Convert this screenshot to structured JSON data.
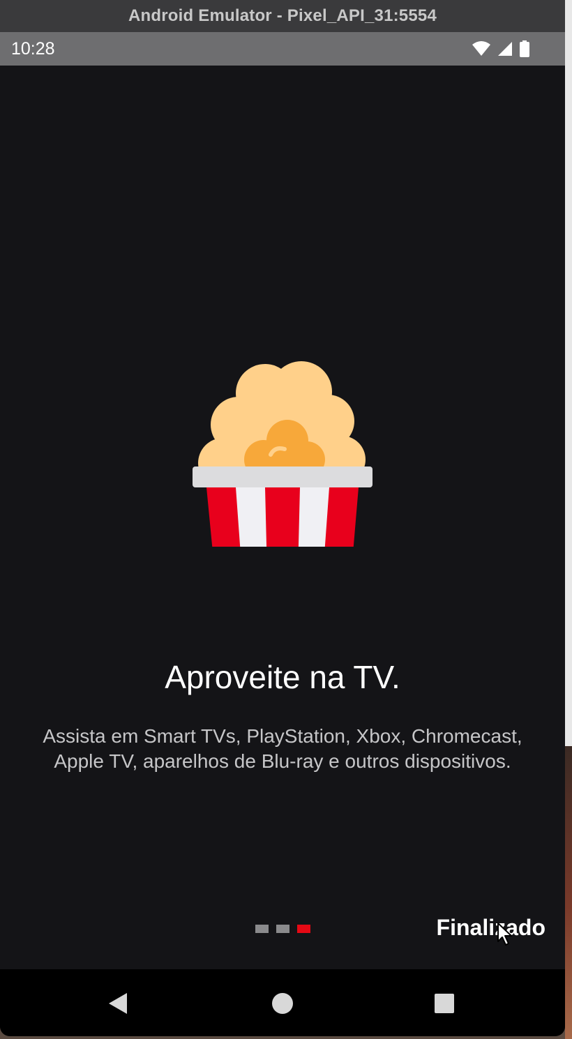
{
  "window": {
    "title": "Android Emulator - Pixel_API_31:5554"
  },
  "status_bar": {
    "time": "10:28",
    "icons": [
      "wifi-icon",
      "cell-signal-icon",
      "battery-icon"
    ]
  },
  "onboarding": {
    "illustration": "popcorn-icon",
    "headline": "Aproveite na TV.",
    "description_line1": "Assista em Smart TVs, PlayStation, Xbox, Chromecast,",
    "description_line2": "Apple TV, aparelhos de Blu-ray e outros dispositivos.",
    "pages_total": 3,
    "current_page": 3,
    "finish_label": "Finalizado"
  },
  "nav_bar": {
    "buttons": [
      "back-icon",
      "home-icon",
      "recents-icon"
    ]
  },
  "colors": {
    "background": "#141417",
    "accent": "#e50914",
    "popcorn_light": "#ffd08a",
    "popcorn_dark": "#f7a83a"
  }
}
